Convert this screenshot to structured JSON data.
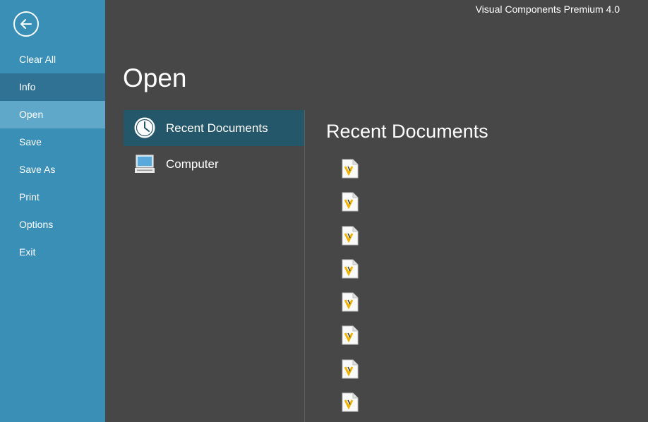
{
  "app": {
    "title": "Visual Components Premium 4.0"
  },
  "sidebar": {
    "back_icon": "back-arrow-icon",
    "items": [
      {
        "label": "Clear All"
      },
      {
        "label": "Info"
      },
      {
        "label": "Open"
      },
      {
        "label": "Save"
      },
      {
        "label": "Save As"
      },
      {
        "label": "Print"
      },
      {
        "label": "Options"
      },
      {
        "label": "Exit"
      }
    ]
  },
  "main": {
    "title": "Open",
    "places": [
      {
        "label": "Recent Documents",
        "icon": "clock-icon",
        "selected": true
      },
      {
        "label": "Computer",
        "icon": "computer-icon",
        "selected": false
      }
    ],
    "recent": {
      "title": "Recent Documents",
      "documents": [
        {
          "name": "",
          "path": ""
        },
        {
          "name": "",
          "path": ""
        },
        {
          "name": "",
          "path": ""
        },
        {
          "name": "",
          "path": ""
        },
        {
          "name": "",
          "path": ""
        },
        {
          "name": "",
          "path": ""
        },
        {
          "name": "",
          "path": ""
        },
        {
          "name": "",
          "path": ""
        }
      ]
    }
  },
  "colors": {
    "sidebar": "#3a8fb7",
    "sidebar_active": "#5fa8ca",
    "sidebar_info": "#2f7294",
    "background": "#474747",
    "place_selected": "#25576b",
    "file_icon_accent": "#f0b400"
  }
}
